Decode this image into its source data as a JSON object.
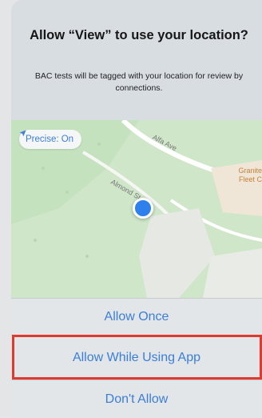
{
  "dialog": {
    "title": "Allow “View” to use your location?",
    "message": "BAC tests will be tagged with your location for review by connections."
  },
  "map": {
    "precise_label": "Precise: On",
    "road_label_1": "Alfa Ave",
    "road_label_2": "Almond St",
    "poi_label_1": "Granite",
    "poi_label_2": "Fleet C"
  },
  "buttons": {
    "allow_once": "Allow Once",
    "allow_while_using": "Allow While Using App",
    "dont_allow": "Don't Allow"
  },
  "colors": {
    "accent": "#3b7ed8",
    "highlight": "#e03a2e",
    "location_dot": "#2f80ed"
  },
  "icons": {
    "precise": "location-arrow-icon"
  }
}
